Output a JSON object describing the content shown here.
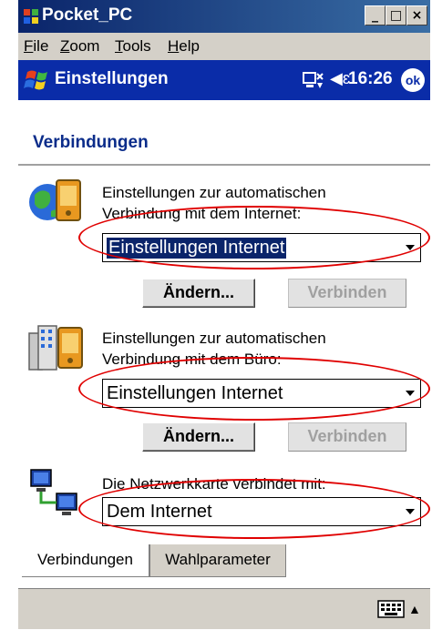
{
  "emulator": {
    "title": "Pocket_PC",
    "controls": [
      "_",
      "□",
      "×"
    ]
  },
  "menu": {
    "items": [
      {
        "label": "File",
        "u": "F",
        "rest": "ile"
      },
      {
        "label": "Zoom",
        "u": "Z",
        "rest": "oom"
      },
      {
        "label": "Tools",
        "u": "T",
        "rest": "ools"
      },
      {
        "label": "Help",
        "u": "H",
        "rest": "elp"
      }
    ]
  },
  "navbar": {
    "title": "Einstellungen",
    "time": "16:26",
    "ok": "ok",
    "speaker": "◀ɛ"
  },
  "page": {
    "heading": "Verbindungen"
  },
  "sections": [
    {
      "desc_line1": "Einstellungen zur automatischen",
      "desc_line2": "Verbindung mit dem Internet:",
      "dropdown": "Einstellungen Internet",
      "btn_change": "Ändern...",
      "btn_connect": "Verbinden"
    },
    {
      "desc_line1": "Einstellungen zur automatischen",
      "desc_line2": "Verbindung mit dem Büro:",
      "dropdown": "Einstellungen Internet",
      "btn_change": "Ändern...",
      "btn_connect": "Verbinden"
    },
    {
      "desc_line1": "Die Netzwerkkarte verbindet mit:",
      "dropdown": "Dem Internet"
    }
  ],
  "tabs": [
    {
      "label": "Verbindungen",
      "active": true
    },
    {
      "label": "Wahlparameter",
      "active": false
    }
  ],
  "annotation_color": "#e00000",
  "nav_color": "#0a2ca8"
}
